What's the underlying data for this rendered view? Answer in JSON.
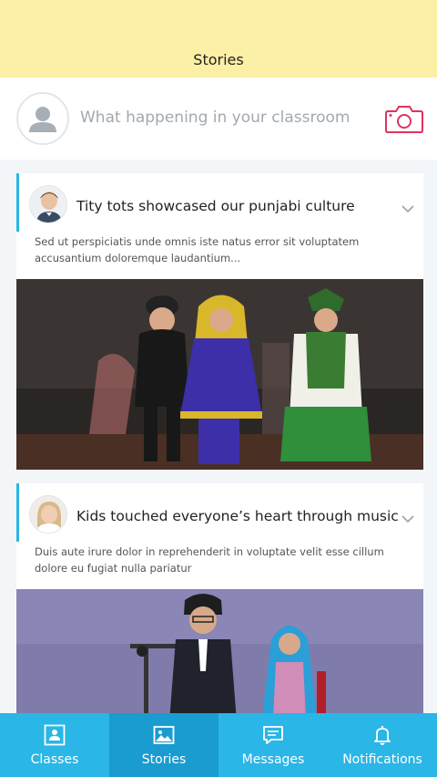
{
  "header": {
    "title": "Stories"
  },
  "composer": {
    "placeholder": "What happening in your classroom",
    "camera_icon": "camera-icon",
    "avatar_icon": "user-placeholder-icon"
  },
  "stories": [
    {
      "title": "Tity tots showcased our punjabi culture",
      "body": "Sed ut perspiciatis unde omnis iste natus error sit voluptatem accusantium doloremque laudantium...",
      "photo": "children-in-traditional-punjabi-costumes-on-stage"
    },
    {
      "title": "Kids touched everyone’s heart through music",
      "body": "Duis aute irure dolor in reprehenderit in voluptate velit esse cillum dolore eu fugiat nulla pariatur",
      "photo": "children-performing-at-microphone-on-stage"
    }
  ],
  "tabs": [
    {
      "label": "Classes",
      "icon": "classes-icon",
      "active": false
    },
    {
      "label": "Stories",
      "icon": "image-icon",
      "active": true
    },
    {
      "label": "Messages",
      "icon": "message-icon",
      "active": false
    },
    {
      "label": "Notifications",
      "icon": "bell-icon",
      "active": false
    }
  ],
  "colors": {
    "header_bg": "#fcefa6",
    "accent": "#2ab6e6",
    "tab_active": "#1a9cd0",
    "camera": "#e0335d"
  }
}
